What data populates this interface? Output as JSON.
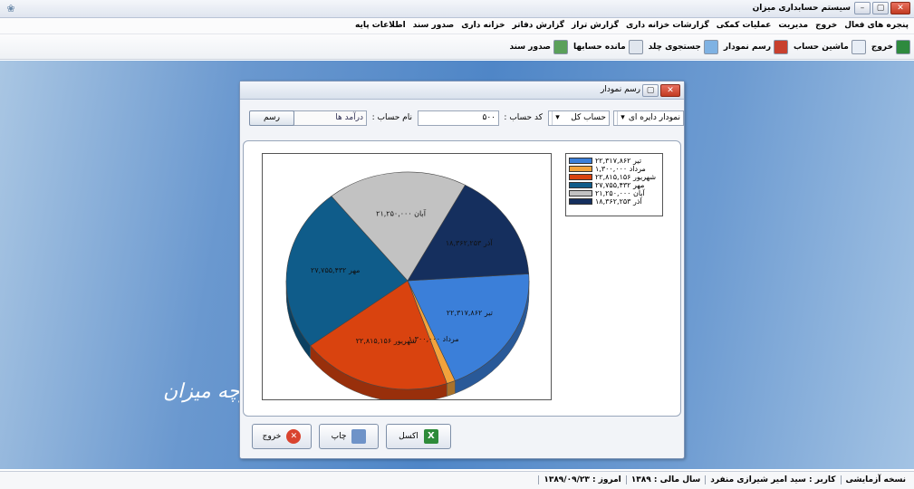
{
  "window": {
    "title": "سیستم حسابداری میزان"
  },
  "menu": [
    "اطلاعات پایه",
    "صدور سند",
    "خزانه داری",
    "گزارش دفاتر",
    "گزارش تراز",
    "گزارشات خزانه داری",
    "عملیات کمکی",
    "مدیریت",
    "خروج",
    "پنجره های فعال"
  ],
  "toolbar": [
    {
      "label": "صدور سند",
      "icon": "document-add-icon",
      "color": "#5aa05a"
    },
    {
      "label": "مانده حسابها",
      "icon": "pencil-icon",
      "color": "#e0e6ee"
    },
    {
      "label": "جستجوی چلد",
      "icon": "search-icon",
      "color": "#7fb2e3"
    },
    {
      "label": "رسم نمودار",
      "icon": "bar-chart-icon",
      "color": "#c8402e"
    },
    {
      "label": "ماشین حساب",
      "icon": "calculator-icon",
      "color": "#e8eef6"
    },
    {
      "label": "خروج",
      "icon": "exit-icon",
      "color": "#2e8a3e"
    }
  ],
  "desktop": {
    "watermark": "رچه میزان"
  },
  "dialog": {
    "title": "رسم نمودار",
    "chart_type": "نمودار دایره ای",
    "account_type": "حساب کل",
    "code_label": "کد حساب :",
    "code_value": "۵۰۰",
    "name_label": "نام حساب :",
    "name_value": "درآمد ها",
    "draw_button": "رسم",
    "excel_button": "اکسل",
    "print_button": "چاپ",
    "exit_button": "خروج"
  },
  "chart_data": {
    "type": "pie",
    "title": "",
    "series": [
      {
        "name": "تیر",
        "value": 22317862,
        "label": "۲۲,۳۱۷,۸۶۲",
        "color": "#3b7fd9"
      },
      {
        "name": "مرداد",
        "value": 1300000,
        "label": "۱,۳۰۰,۰۰۰",
        "color": "#f2a33c"
      },
      {
        "name": "شهریور",
        "value": 22815156,
        "label": "۲۲,۸۱۵,۱۵۶",
        "color": "#d9430f"
      },
      {
        "name": "مهر",
        "value": 27755432,
        "label": "۲۷,۷۵۵,۴۳۲",
        "color": "#0f5c8a"
      },
      {
        "name": "آبان",
        "value": 21250000,
        "label": "۲۱,۲۵۰,۰۰۰",
        "color": "#c2c2c2"
      },
      {
        "name": "آذر",
        "value": 18362253,
        "label": "۱۸,۳۶۲,۲۵۳",
        "color": "#152f5e"
      }
    ],
    "legend": "top-right"
  },
  "status": [
    {
      "label": "امروز :",
      "value": "۱۳۸۹/۰۹/۲۳"
    },
    {
      "label": "سال مالی :",
      "value": "۱۳۸۹"
    },
    {
      "label": "کاربر :",
      "value": "سید امیر شیرازی منفرد"
    },
    {
      "label": "",
      "value": "نسخه آزمایشی"
    }
  ]
}
